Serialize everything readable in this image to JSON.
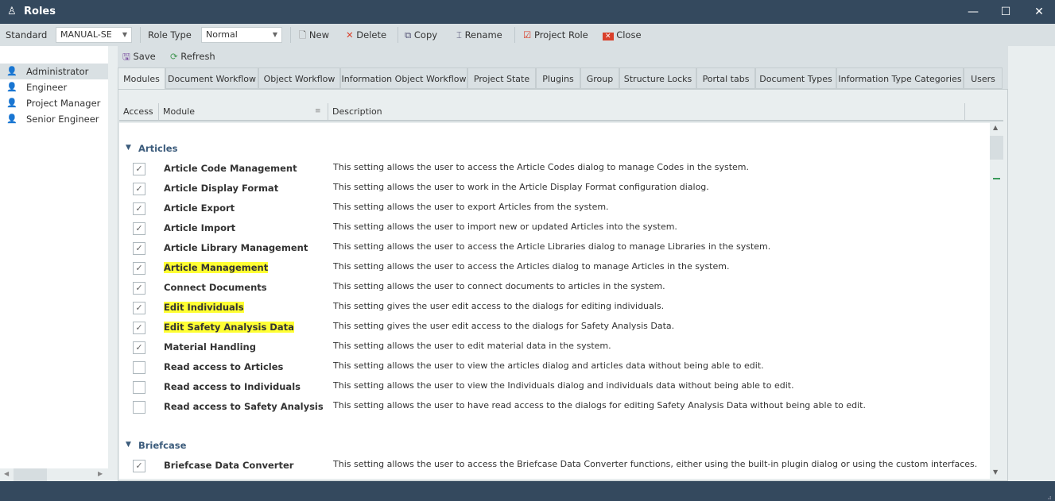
{
  "window": {
    "title": "Roles",
    "minimize": "—",
    "maximize": "☐",
    "close": "✕"
  },
  "toolbar": {
    "standard_label": "Standard",
    "standard_value": "MANUAL-SE",
    "role_type_label": "Role Type",
    "role_type_value": "Normal",
    "new": "New",
    "delete": "Delete",
    "copy": "Copy",
    "rename": "Rename",
    "project_role": "Project Role",
    "close": "Close"
  },
  "subtoolbar": {
    "save": "Save",
    "refresh": "Refresh"
  },
  "roles": [
    {
      "label": "Administrator",
      "selected": true
    },
    {
      "label": "Engineer"
    },
    {
      "label": "Project Manager"
    },
    {
      "label": "Senior Engineer"
    }
  ],
  "tabs": [
    {
      "label": "Modules",
      "active": true
    },
    {
      "label": "Document Workflow"
    },
    {
      "label": "Object Workflow"
    },
    {
      "label": "Information Object Workflow"
    },
    {
      "label": "Project State"
    },
    {
      "label": "Plugins"
    },
    {
      "label": "Group"
    },
    {
      "label": "Structure Locks"
    },
    {
      "label": "Portal tabs"
    },
    {
      "label": "Document Types"
    },
    {
      "label": "Information Type Categories"
    },
    {
      "label": "Users"
    }
  ],
  "grid": {
    "columns": {
      "access": "Access",
      "module": "Module",
      "description": "Description"
    },
    "groups": [
      {
        "name": "Articles",
        "rows": [
          {
            "module": "Article Code Management",
            "checked": true,
            "highlight": false,
            "description": "This setting allows the user to access the Article Codes dialog to manage Codes in the system."
          },
          {
            "module": "Article Display Format",
            "checked": true,
            "highlight": false,
            "description": "This setting allows the user to work in the Article Display Format configuration dialog."
          },
          {
            "module": "Article Export",
            "checked": true,
            "highlight": false,
            "description": "This setting allows the user to export Articles from the system."
          },
          {
            "module": "Article Import",
            "checked": true,
            "highlight": false,
            "description": "This setting allows the user to import new or updated Articles into the system."
          },
          {
            "module": "Article Library Management",
            "checked": true,
            "highlight": false,
            "description": "This setting allows the user to access the Article Libraries dialog to manage Libraries in the system."
          },
          {
            "module": "Article Management",
            "checked": true,
            "highlight": true,
            "description": "This setting allows the user to access the Articles dialog to manage Articles in the system."
          },
          {
            "module": "Connect Documents",
            "checked": true,
            "highlight": false,
            "description": "This setting allows the user to connect documents to articles in the system."
          },
          {
            "module": "Edit Individuals",
            "checked": true,
            "highlight": true,
            "description": "This setting gives the user edit access to the dialogs for editing individuals."
          },
          {
            "module": "Edit Safety Analysis Data",
            "checked": true,
            "highlight": true,
            "description": "This setting gives the user edit access to the dialogs for Safety Analysis Data."
          },
          {
            "module": "Material Handling",
            "checked": true,
            "highlight": false,
            "description": "This setting allows the user to edit material data in the system."
          },
          {
            "module": "Read access to Articles",
            "checked": false,
            "highlight": false,
            "description": "This setting allows the user to view the articles dialog and articles data without being able to edit."
          },
          {
            "module": "Read access to Individuals",
            "checked": false,
            "highlight": false,
            "description": "This setting allows the user to view the Individuals dialog and individuals data without being able to edit."
          },
          {
            "module": "Read access to Safety Analysis",
            "checked": false,
            "highlight": false,
            "description": "This setting allows the user to have read access to the dialogs for editing Safety Analysis Data without being able to edit."
          }
        ]
      },
      {
        "name": "Briefcase",
        "rows": [
          {
            "module": "Briefcase Data Converter",
            "checked": true,
            "highlight": false,
            "description": "This setting allows the user to access the Briefcase Data Converter functions, either using the built-in plugin dialog or using the custom interfaces."
          }
        ]
      }
    ]
  },
  "colors": {
    "titlebar": "#34495e",
    "highlight": "#ffff33",
    "group_text": "#3b5b7b"
  }
}
